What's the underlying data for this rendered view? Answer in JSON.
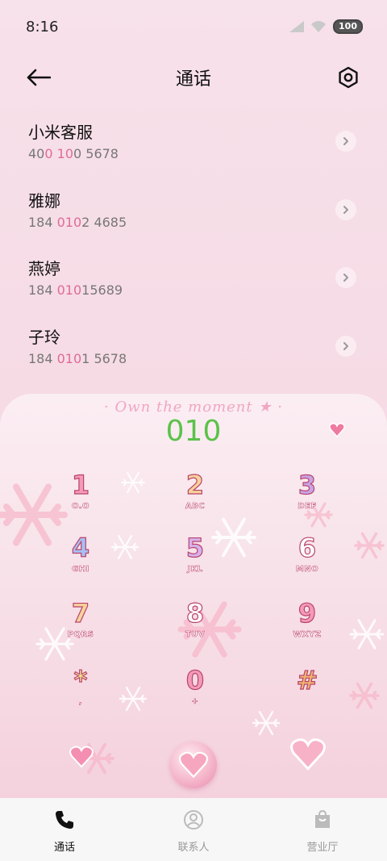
{
  "status_bar": {
    "time": "8:16",
    "battery": "100"
  },
  "header": {
    "title": "通话"
  },
  "contacts": [
    {
      "name": "小米客服",
      "number_parts": [
        {
          "t": "40",
          "hl": false
        },
        {
          "t": "0",
          "hl": true
        },
        {
          "t": " ",
          "hl": false
        },
        {
          "t": "10",
          "hl": true
        },
        {
          "t": "0 5678",
          "hl": false
        }
      ]
    },
    {
      "name": "雅娜",
      "number_parts": [
        {
          "t": "184 ",
          "hl": false
        },
        {
          "t": "010",
          "hl": true
        },
        {
          "t": "2 4685",
          "hl": false
        }
      ]
    },
    {
      "name": "燕婷",
      "number_parts": [
        {
          "t": "184 ",
          "hl": false
        },
        {
          "t": "010",
          "hl": true
        },
        {
          "t": "15689",
          "hl": false
        }
      ]
    },
    {
      "name": "子玲",
      "number_parts": [
        {
          "t": "184 ",
          "hl": false
        },
        {
          "t": "010",
          "hl": true
        },
        {
          "t": "1 5678",
          "hl": false
        }
      ]
    }
  ],
  "dialer": {
    "decorative_text": "· Own the moment ★ ·",
    "display_value": "010",
    "keys": [
      {
        "digit": "1",
        "letters": "O.O",
        "color": "#f49ab8"
      },
      {
        "digit": "2",
        "letters": "ABC",
        "color": "#f7d49a"
      },
      {
        "digit": "3",
        "letters": "DEF",
        "color": "#c9a4e6"
      },
      {
        "digit": "4",
        "letters": "GHI",
        "color": "#a8c0f2"
      },
      {
        "digit": "5",
        "letters": "JKL",
        "color": "#d7b2ee"
      },
      {
        "digit": "6",
        "letters": "MNO",
        "color": "#ffffff"
      },
      {
        "digit": "7",
        "letters": "PQRS",
        "color": "#f7d49a"
      },
      {
        "digit": "8",
        "letters": "TUV",
        "color": "#ffffff"
      },
      {
        "digit": "9",
        "letters": "WXYZ",
        "color": "#f49ab8"
      },
      {
        "digit": "*",
        "letters": ",",
        "color": "#f3e58f"
      },
      {
        "digit": "0",
        "letters": "+",
        "color": "#f49ab8"
      },
      {
        "digit": "#",
        "letters": "",
        "color": "#f0b66e"
      }
    ]
  },
  "bottom_nav": [
    {
      "label": "通话",
      "icon": "phone-icon",
      "active": true
    },
    {
      "label": "联系人",
      "icon": "contact-icon",
      "active": false
    },
    {
      "label": "营业厅",
      "icon": "bag-icon",
      "active": false
    }
  ],
  "colors": {
    "highlight": "#e06b96",
    "display_green": "#5bc24a",
    "accent_pink": "#f0a6c2"
  }
}
